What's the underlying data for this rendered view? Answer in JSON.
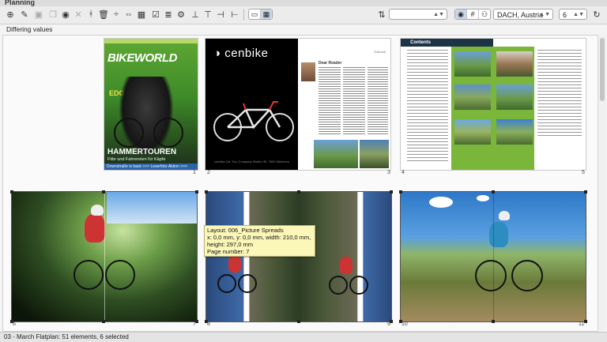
{
  "window": {
    "tab_title": "Planning"
  },
  "toolbar": {
    "icons": [
      "new-icon",
      "pencil-icon",
      "duplicate-icon",
      "copy-icon",
      "eye-icon",
      "close-icon",
      "clear-format-icon",
      "trash-icon",
      "split-icon",
      "move-icon",
      "table-icon",
      "checkbox-icon",
      "list-icon",
      "gear-icon",
      "align-bottom-icon",
      "align-top-icon",
      "align-right-icon"
    ],
    "sort_select": {
      "value": ""
    },
    "region_select": {
      "value": "DACH, Austria"
    },
    "columns_select": {
      "value": "6"
    }
  },
  "status_top": "Differing values",
  "pages": {
    "cover": {
      "masthead": "BIKEWORLD",
      "edge": "EDGE PARTS",
      "headline": "HAMMERTOUREN",
      "sub": "Fitte und Fahrereien für Käpfe",
      "band": "Downstraße is back >>> Leserfoto-Aktion >>> Pulsdeckel"
    },
    "ad": {
      "logo": "cenbike",
      "fine": "cenbike Ltd. Fun Company Straße 95, 7600 München"
    },
    "editorial": {
      "title": "Dear Reader",
      "label": "Editorial"
    },
    "toc": {
      "title": "Contents"
    }
  },
  "page_numbers": [
    "1",
    "2",
    "3",
    "4",
    "5",
    "6",
    "7",
    "8",
    "9",
    "10",
    "11"
  ],
  "tooltip": {
    "line1": "Layout: 006_Picture Spreads",
    "line2": "x: 0,0 mm, y: 0,0 mm, width: 210,0 mm, height: 297,0 mm",
    "line3": "Page number: 7"
  },
  "status_bottom": "03 - March Flatplan: 51 elements, 6 selected"
}
